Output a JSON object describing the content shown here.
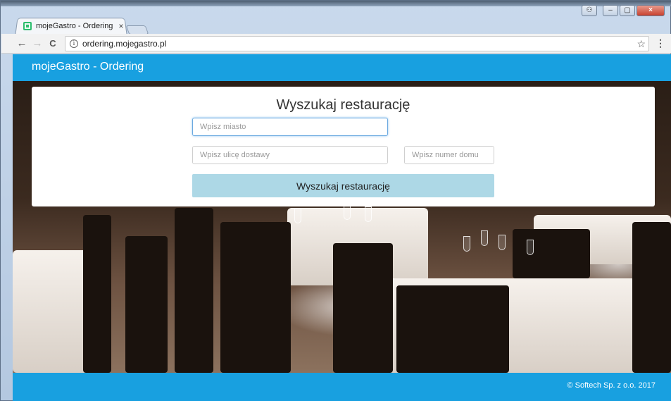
{
  "browser": {
    "tab": {
      "title": "mojeGastro - Ordering",
      "close": "×"
    },
    "controls": {
      "user": "⚇",
      "minimize": "–",
      "maximize": "▢",
      "close": "×"
    },
    "nav": {
      "back": "←",
      "forward": "→",
      "reload": "C"
    },
    "address": {
      "url": "ordering.mojegastro.pl",
      "info": "i"
    },
    "icons": {
      "star": "☆",
      "menu": "⋮"
    }
  },
  "header": {
    "brand": "mojeGastro - Ordering"
  },
  "search": {
    "title": "Wyszukaj restaurację",
    "city_placeholder": "Wpisz miasto",
    "street_placeholder": "Wpisz ulicę dostawy",
    "house_placeholder": "Wpisz numer domu",
    "button_label": "Wyszukaj restaurację"
  },
  "footer": {
    "copyright": "© Softech Sp. z o.o. 2017"
  },
  "colors": {
    "brand": "#18a0e0",
    "button": "#add8e6"
  }
}
